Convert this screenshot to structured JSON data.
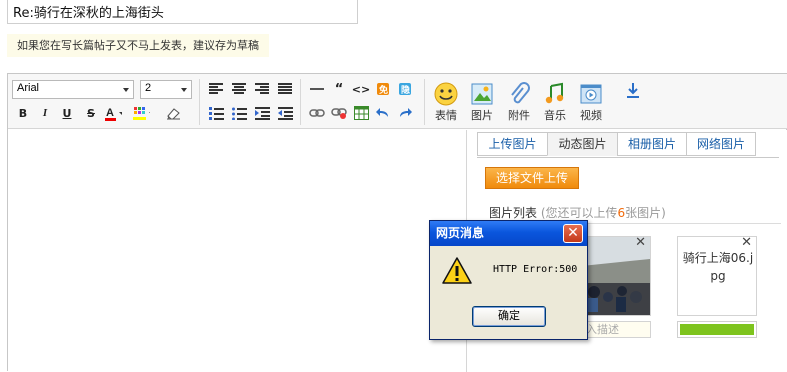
{
  "title_input": {
    "value": "Re:骑行在深秋的上海街头"
  },
  "draft_tip": "如果您在写长篇帖子又不马上发表，建议存为草稿",
  "toolbar": {
    "font_family": "Arial",
    "font_size": "2",
    "big_buttons": [
      {
        "label": "表情",
        "icon": "emoji-icon"
      },
      {
        "label": "图片",
        "icon": "image-icon"
      },
      {
        "label": "附件",
        "icon": "paperclip-icon"
      },
      {
        "label": "音乐",
        "icon": "music-icon"
      },
      {
        "label": "视频",
        "icon": "video-icon"
      }
    ]
  },
  "side_panel": {
    "tabs": [
      "上传图片",
      "动态图片",
      "相册图片",
      "网络图片"
    ],
    "active_tab": 1,
    "upload_button": "选择文件上传",
    "list_title": "图片列表",
    "list_hint_prefix": "(您还可以上传",
    "list_hint_count": "6",
    "list_hint_suffix": "张图片)",
    "images": [
      {
        "desc_placeholder": "输入描述"
      },
      {
        "filename": "骑行上海06.jpg",
        "progress": 1.0
      }
    ]
  },
  "dialog": {
    "title": "网页消息",
    "message": "HTTP Error:500",
    "ok_label": "确定",
    "close_symbol": "✕"
  },
  "colors": {
    "upload_button": "#f08a0b",
    "progress_fill": "#7ec41e",
    "dialog_title": "#0a56dd",
    "hint_count": "#f26a0a"
  }
}
